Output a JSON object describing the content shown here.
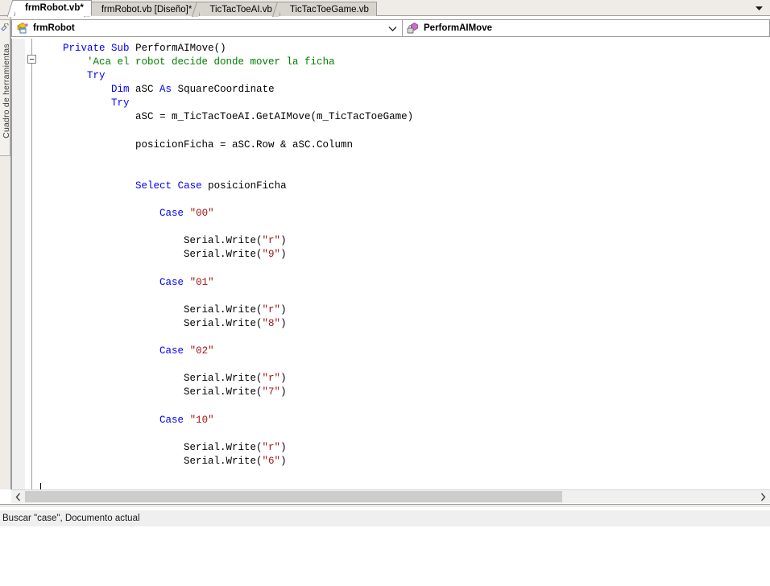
{
  "window": {
    "tabs": [
      {
        "label": "frmRobot.vb*",
        "active": true
      },
      {
        "label": "frmRobot.vb [Diseño]*",
        "active": false
      },
      {
        "label": "TicTacToeAI.vb",
        "active": false
      },
      {
        "label": "TicTacToeGame.vb",
        "active": false
      }
    ],
    "tab_overflow_icon": "chevron-down-icon"
  },
  "navbar": {
    "class_combo": {
      "icon": "vb-form-icon",
      "value": "frmRobot",
      "arrow_icon": "chevron-down-icon"
    },
    "member_combo": {
      "icon": "private-method-icon",
      "value": "PerformAIMove"
    }
  },
  "toolbox": {
    "label": "Cuadro de herramientas",
    "icon": "toolbox-icon"
  },
  "editor": {
    "fold_state": "expanded",
    "colors": {
      "keyword": "#0000FF",
      "comment": "#008000",
      "string": "#A31515",
      "text": "#000000",
      "background": "#FFFFFF"
    },
    "lines": [
      [
        {
          "t": "    ",
          "c": "p"
        },
        {
          "t": "Private",
          "c": "k"
        },
        {
          "t": " ",
          "c": "p"
        },
        {
          "t": "Sub",
          "c": "k"
        },
        {
          "t": " PerformAIMove()",
          "c": "p"
        }
      ],
      [
        {
          "t": "        ",
          "c": "p"
        },
        {
          "t": "'Aca el robot decide donde mover la ficha",
          "c": "cm"
        }
      ],
      [
        {
          "t": "        ",
          "c": "p"
        },
        {
          "t": "Try",
          "c": "k"
        }
      ],
      [
        {
          "t": "            ",
          "c": "p"
        },
        {
          "t": "Dim",
          "c": "k"
        },
        {
          "t": " aSC ",
          "c": "p"
        },
        {
          "t": "As",
          "c": "k"
        },
        {
          "t": " SquareCoordinate",
          "c": "p"
        }
      ],
      [
        {
          "t": "            ",
          "c": "p"
        },
        {
          "t": "Try",
          "c": "k"
        }
      ],
      [
        {
          "t": "                aSC = m_TicTacToeAI.GetAIMove(m_TicTacToeGame)",
          "c": "p"
        }
      ],
      [
        {
          "t": "",
          "c": "p"
        }
      ],
      [
        {
          "t": "                posicionFicha = aSC.Row & aSC.Column",
          "c": "p"
        }
      ],
      [
        {
          "t": "",
          "c": "p"
        }
      ],
      [
        {
          "t": "",
          "c": "p"
        }
      ],
      [
        {
          "t": "                ",
          "c": "p"
        },
        {
          "t": "Select",
          "c": "k"
        },
        {
          "t": " ",
          "c": "p"
        },
        {
          "t": "Case",
          "c": "k"
        },
        {
          "t": " posicionFicha",
          "c": "p"
        }
      ],
      [
        {
          "t": "",
          "c": "p"
        }
      ],
      [
        {
          "t": "                    ",
          "c": "p"
        },
        {
          "t": "Case",
          "c": "k"
        },
        {
          "t": " ",
          "c": "p"
        },
        {
          "t": "\"00\"",
          "c": "st"
        }
      ],
      [
        {
          "t": "",
          "c": "p"
        }
      ],
      [
        {
          "t": "                        Serial.Write(",
          "c": "p"
        },
        {
          "t": "\"r\"",
          "c": "st"
        },
        {
          "t": ")",
          "c": "p"
        }
      ],
      [
        {
          "t": "                        Serial.Write(",
          "c": "p"
        },
        {
          "t": "\"9\"",
          "c": "st"
        },
        {
          "t": ")",
          "c": "p"
        }
      ],
      [
        {
          "t": "",
          "c": "p"
        }
      ],
      [
        {
          "t": "                    ",
          "c": "p"
        },
        {
          "t": "Case",
          "c": "k"
        },
        {
          "t": " ",
          "c": "p"
        },
        {
          "t": "\"01\"",
          "c": "st"
        }
      ],
      [
        {
          "t": "",
          "c": "p"
        }
      ],
      [
        {
          "t": "                        Serial.Write(",
          "c": "p"
        },
        {
          "t": "\"r\"",
          "c": "st"
        },
        {
          "t": ")",
          "c": "p"
        }
      ],
      [
        {
          "t": "                        Serial.Write(",
          "c": "p"
        },
        {
          "t": "\"8\"",
          "c": "st"
        },
        {
          "t": ")",
          "c": "p"
        }
      ],
      [
        {
          "t": "",
          "c": "p"
        }
      ],
      [
        {
          "t": "                    ",
          "c": "p"
        },
        {
          "t": "Case",
          "c": "k"
        },
        {
          "t": " ",
          "c": "p"
        },
        {
          "t": "\"02\"",
          "c": "st"
        }
      ],
      [
        {
          "t": "",
          "c": "p"
        }
      ],
      [
        {
          "t": "                        Serial.Write(",
          "c": "p"
        },
        {
          "t": "\"r\"",
          "c": "st"
        },
        {
          "t": ")",
          "c": "p"
        }
      ],
      [
        {
          "t": "                        Serial.Write(",
          "c": "p"
        },
        {
          "t": "\"7\"",
          "c": "st"
        },
        {
          "t": ")",
          "c": "p"
        }
      ],
      [
        {
          "t": "",
          "c": "p"
        }
      ],
      [
        {
          "t": "                    ",
          "c": "p"
        },
        {
          "t": "Case",
          "c": "k"
        },
        {
          "t": " ",
          "c": "p"
        },
        {
          "t": "\"10\"",
          "c": "st"
        }
      ],
      [
        {
          "t": "",
          "c": "p"
        }
      ],
      [
        {
          "t": "                        Serial.Write(",
          "c": "p"
        },
        {
          "t": "\"r\"",
          "c": "st"
        },
        {
          "t": ")",
          "c": "p"
        }
      ],
      [
        {
          "t": "                        Serial.Write(",
          "c": "p"
        },
        {
          "t": "\"6\"",
          "c": "st"
        },
        {
          "t": ")",
          "c": "p"
        }
      ]
    ]
  },
  "hscrollbar": {
    "left_arrow": "chevron-left-icon",
    "right_arrow": "chevron-right-icon",
    "thumb_position_pct": 0,
    "thumb_width_pct": 72
  },
  "statusbar": {
    "message": "Buscar \"case\", Documento actual"
  }
}
